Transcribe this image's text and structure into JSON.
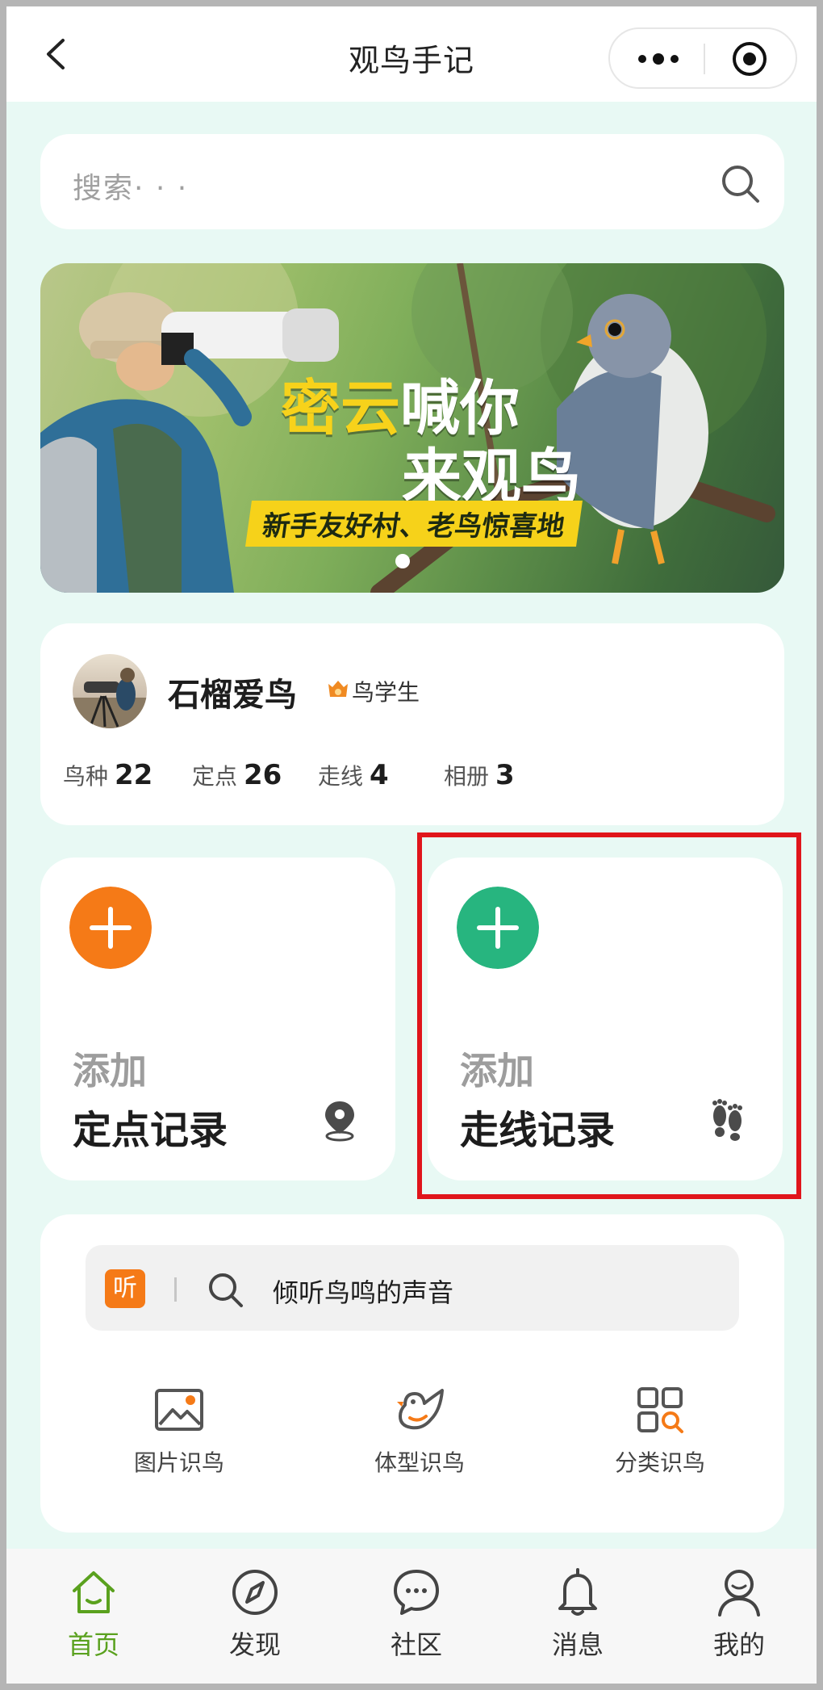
{
  "nav": {
    "title": "观鸟手记"
  },
  "search": {
    "placeholder": "搜索· · ·"
  },
  "banner": {
    "headline_part1": "密云",
    "headline_part2": "喊你",
    "headline_line2": "来观鸟",
    "tagline": "新手友好村、老鸟惊喜地"
  },
  "profile": {
    "username": "石榴爱鸟",
    "badge": "鸟学生",
    "stats": [
      {
        "label": "鸟种",
        "value": "22"
      },
      {
        "label": "定点",
        "value": "26"
      },
      {
        "label": "走线",
        "value": "4"
      },
      {
        "label": "相册",
        "value": "3"
      }
    ]
  },
  "add_point": {
    "label": "添加",
    "title": "定点记录",
    "color": "#f57a17"
  },
  "add_route": {
    "label": "添加",
    "title": "走线记录",
    "color": "#27b57f"
  },
  "tools": {
    "listen_badge": "听",
    "listen_text": "倾听鸟鸣的声音",
    "items": [
      {
        "label": "图片识鸟"
      },
      {
        "label": "体型识鸟"
      },
      {
        "label": "分类识鸟"
      }
    ]
  },
  "tabbar": {
    "active_color": "#5aa11e",
    "items": [
      {
        "label": "首页"
      },
      {
        "label": "发现"
      },
      {
        "label": "社区"
      },
      {
        "label": "消息"
      },
      {
        "label": "我的"
      }
    ]
  }
}
